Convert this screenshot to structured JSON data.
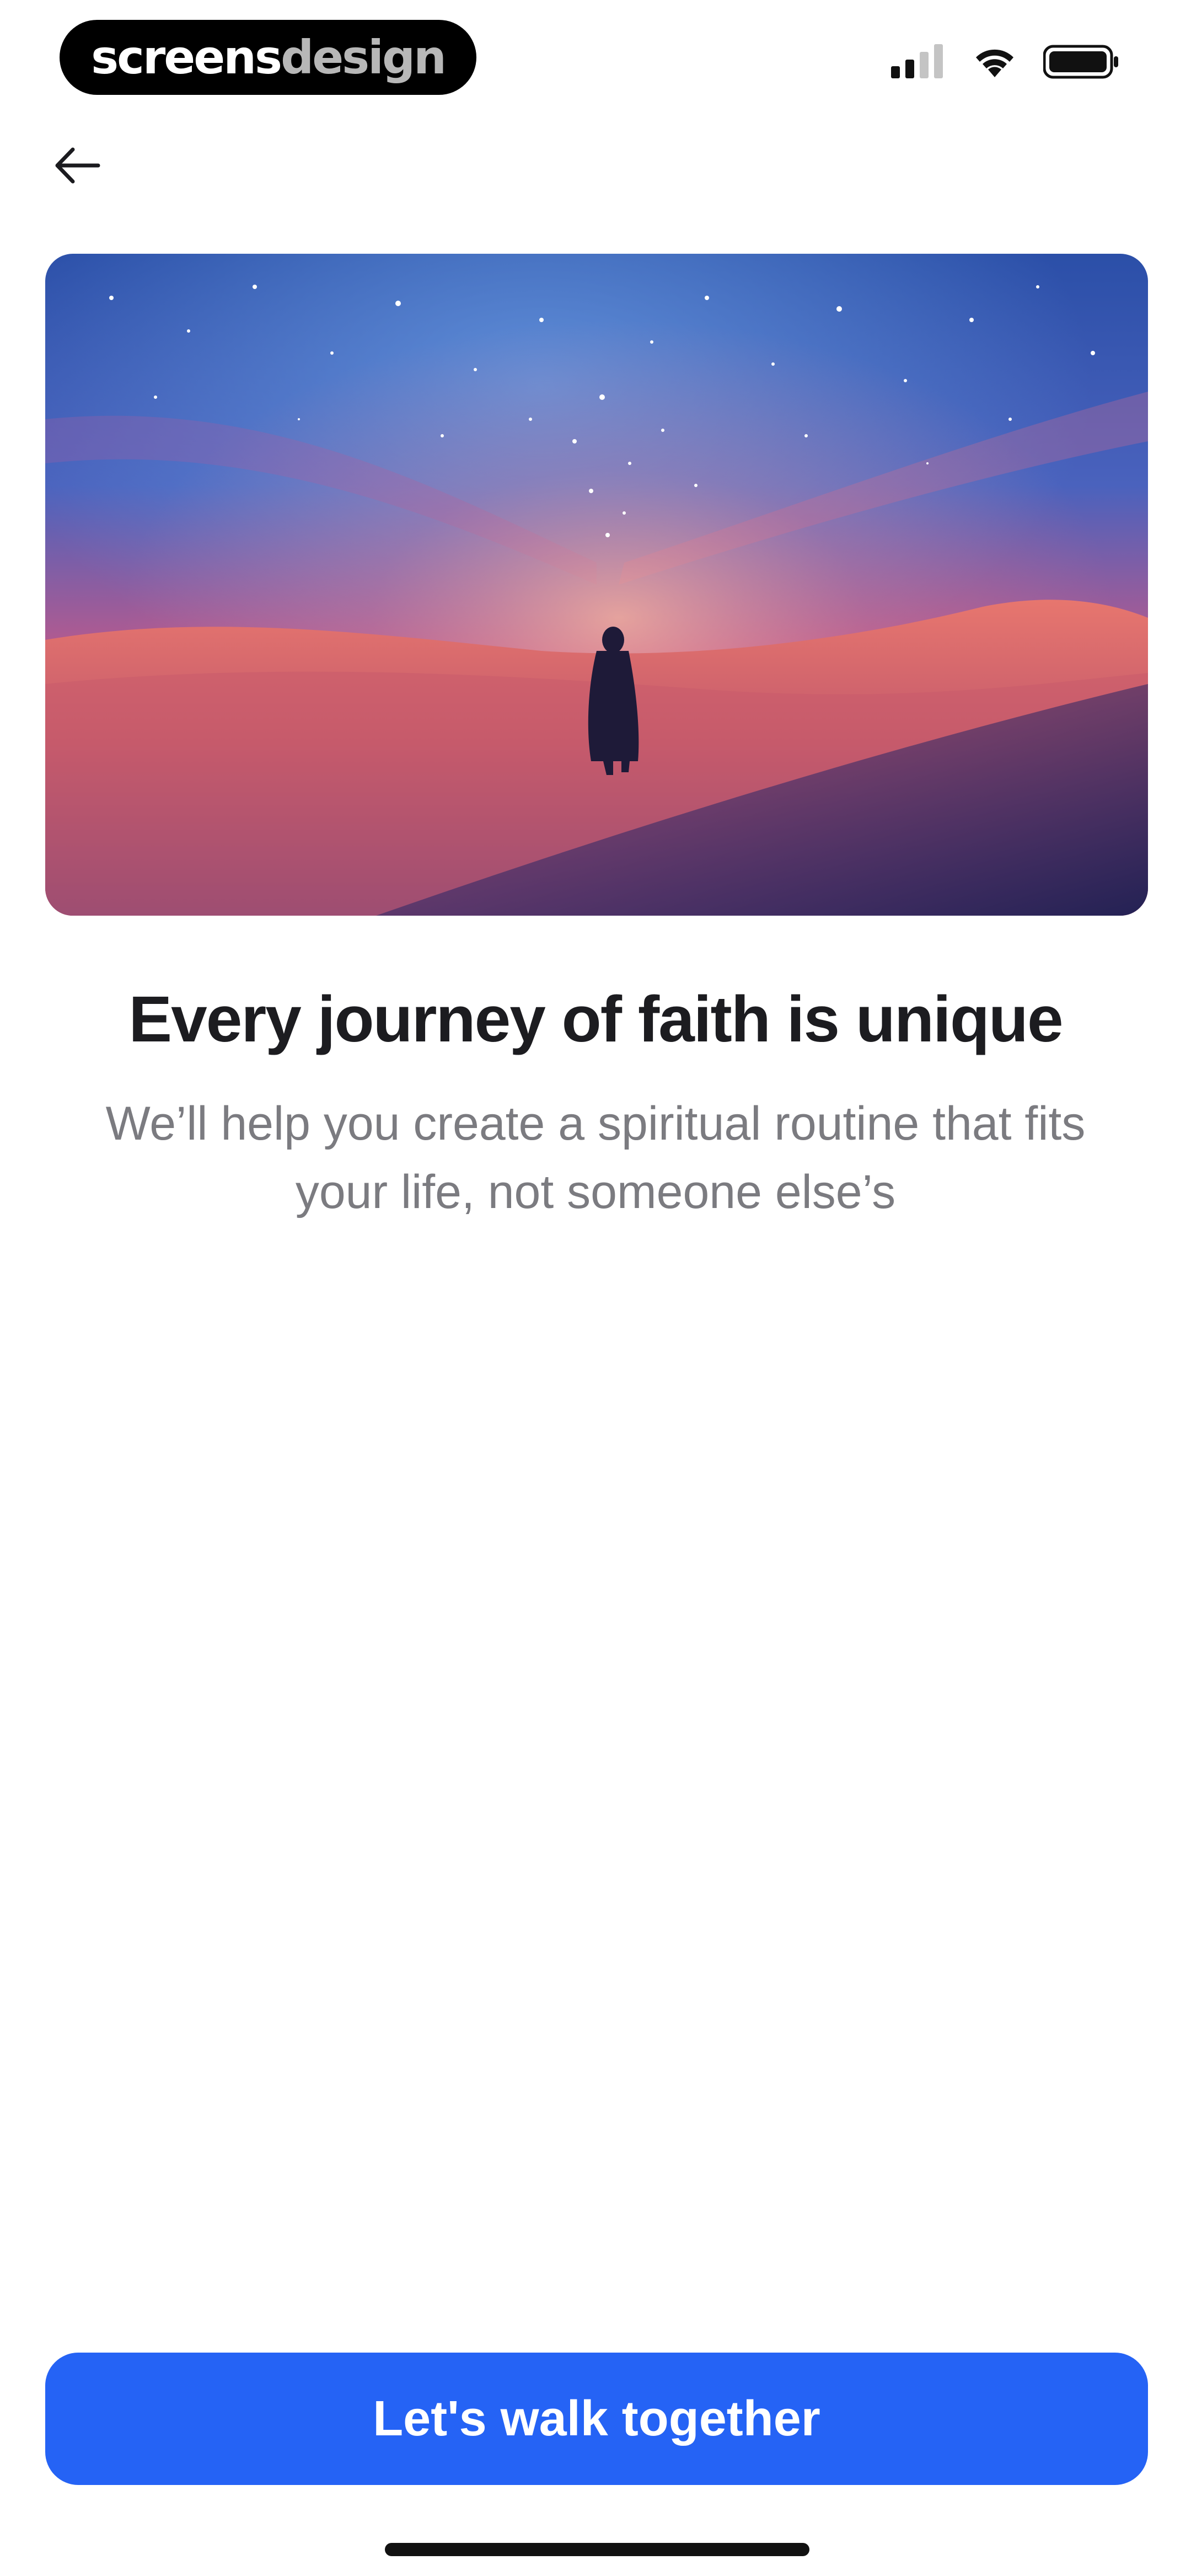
{
  "status_bar": {
    "brand_part1": "screens",
    "brand_part2": "design",
    "icons": [
      "signal-icon",
      "wifi-icon",
      "battery-icon"
    ]
  },
  "nav": {
    "back_icon": "arrow-left-icon"
  },
  "hero": {
    "image": "desert-night-sky-traveler"
  },
  "content": {
    "title": "Every journey of faith is unique",
    "subtitle": "We’ll help you create a spiritual routine that fits your life, not someone else’s"
  },
  "cta": {
    "label": "Let's walk together"
  },
  "colors": {
    "accent": "#2563f5",
    "title": "#1c1c20",
    "subtitle": "#7b7b80",
    "background": "#ffffff"
  }
}
